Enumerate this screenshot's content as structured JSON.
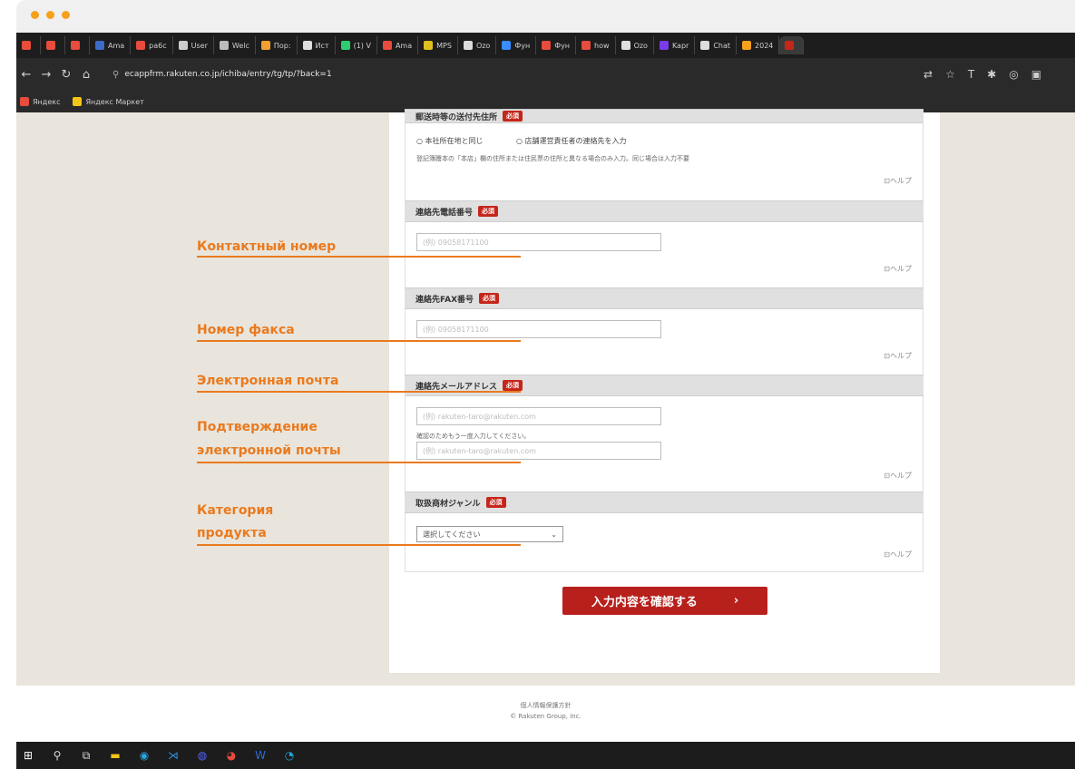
{
  "browser": {
    "tabs": [
      {
        "label": "",
        "color": "#e74c3c"
      },
      {
        "label": "",
        "color": "#e74c3c"
      },
      {
        "label": "",
        "color": "#e74c3c"
      },
      {
        "label": "Ama",
        "color": "#3b6cc8"
      },
      {
        "label": "ра6c",
        "color": "#e74c3c"
      },
      {
        "label": "User",
        "color": "#cccccc"
      },
      {
        "label": "Welc",
        "color": "#bbbbbb"
      },
      {
        "label": "Пор:",
        "color": "#f0a030"
      },
      {
        "label": "Ист",
        "color": "#dddddd"
      },
      {
        "label": "(1) V",
        "color": "#2ecc71"
      },
      {
        "label": "Ama",
        "color": "#e74c3c"
      },
      {
        "label": "MPS",
        "color": "#e0c020"
      },
      {
        "label": "Ozo",
        "color": "#dddddd"
      },
      {
        "label": "Фун",
        "color": "#3a8cff"
      },
      {
        "label": "Фун",
        "color": "#e74c3c"
      },
      {
        "label": "how",
        "color": "#e74c3c"
      },
      {
        "label": "Ozo",
        "color": "#dddddd"
      },
      {
        "label": "Kapr",
        "color": "#7c3aed"
      },
      {
        "label": "Chat",
        "color": "#dddddd"
      },
      {
        "label": "2024",
        "color": "#f5a11c"
      },
      {
        "label": "",
        "color": "#c5261a"
      }
    ],
    "url": "ecappfrm.rakuten.co.jp/ichiba/entry/tg/tp/?back=1",
    "bookmarks": [
      {
        "label": "Яндекс",
        "color": "#e74c3c"
      },
      {
        "label": "Яндекс Маркет",
        "color": "#f5c518"
      }
    ]
  },
  "form": {
    "address_section_label": "郵送時等の送付先住所",
    "required_badge": "必須",
    "radio_1": "○ 本社所在地と同じ",
    "radio_2": "○ 店舗運営責任者の連絡先を入力",
    "address_note": "登記簿謄本の「本店」欄の住所または住民票の住所と異なる場合のみ入力。同じ場合は入力不要",
    "help_label": "⊡ヘルプ",
    "phone_label": "連絡先電話番号",
    "phone_placeholder": "(例) 09058171100",
    "fax_label": "連絡先FAX番号",
    "fax_placeholder": "(例) 09058171100",
    "email_label": "連絡先メールアドレス",
    "email_placeholder": "(例) rakuten-taro@rakuten.com",
    "email_confirm_note": "確認のためもう一度入力してください。",
    "email_confirm_placeholder": "(例) rakuten-taro@rakuten.com",
    "genre_label": "取扱商材ジャンル",
    "genre_select": "選択してください",
    "confirm_button": "入力内容を確認する",
    "confirm_arrow": "›"
  },
  "footer": {
    "privacy": "個人情報保護方針",
    "copyright": "© Rakuten Group, Inc."
  },
  "annotations": {
    "phone": "Контактный номер",
    "fax": "Номер факса",
    "email": "Электронная почта",
    "email_confirm_1": "Подтверждение",
    "email_confirm_2": "электронной почты",
    "category_1": "Категория",
    "category_2": "продукта"
  },
  "colors": {
    "accent": "#ea7a1e",
    "button": "#b7201b",
    "page_bg": "#e9e5dc"
  }
}
